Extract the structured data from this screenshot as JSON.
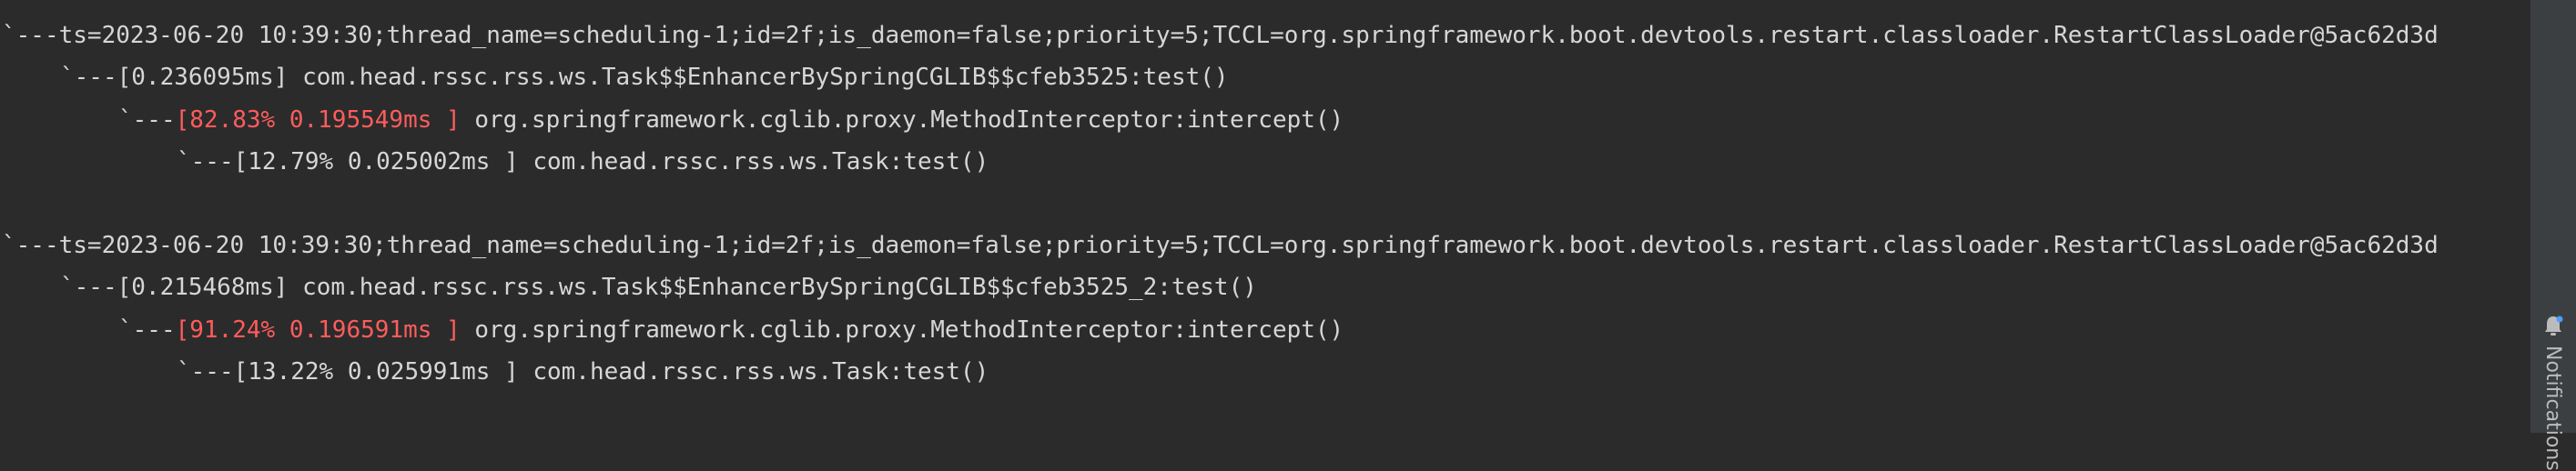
{
  "trace_blocks": [
    {
      "header": "`---ts=2023-06-20 10:39:30;thread_name=scheduling-1;id=2f;is_daemon=false;priority=5;TCCL=org.springframework.boot.devtools.restart.classloader.RestartClassLoader@5ac62d3d",
      "level1": "`---[0.236095ms] com.head.rssc.rss.ws.Task$$EnhancerBySpringCGLIB$$cfeb3525:test()",
      "level2_prefix": "`---",
      "level2_hot": "[82.83% 0.195549ms ]",
      "level2_method": " org.springframework.cglib.proxy.MethodInterceptor:intercept()",
      "level3": "`---[12.79% 0.025002ms ] com.head.rssc.rss.ws.Task:test()"
    },
    {
      "header": "`---ts=2023-06-20 10:39:30;thread_name=scheduling-1;id=2f;is_daemon=false;priority=5;TCCL=org.springframework.boot.devtools.restart.classloader.RestartClassLoader@5ac62d3d",
      "level1": "`---[0.215468ms] com.head.rssc.rss.ws.Task$$EnhancerBySpringCGLIB$$cfeb3525_2:test()",
      "level2_prefix": "`---",
      "level2_hot": "[91.24% 0.196591ms ]",
      "level2_method": " org.springframework.cglib.proxy.MethodInterceptor:intercept()",
      "level3": "`---[13.22% 0.025991ms ] com.head.rssc.rss.ws.Task:test()"
    }
  ],
  "side_panel": {
    "notifications_label": "Notifications",
    "notifications_icon": "bell-icon"
  },
  "colors": {
    "background": "#2b2b2b",
    "text": "#d6d6d6",
    "hot": "#ff5c5c",
    "side_strip": "#3c3f41"
  }
}
